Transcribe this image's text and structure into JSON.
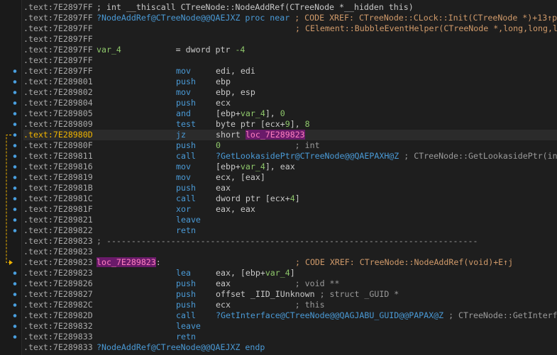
{
  "colors": {
    "background": "#1e1e1e",
    "address": "#a9a9a9",
    "mnemonic": "#4a9ad6",
    "name": "#4a9ad6",
    "number": "#8fc86b",
    "comment": "#9a9a9a",
    "xref": "#d09a6a",
    "highlight_bg": "#6a1a6a",
    "highlight_fg": "#ff7fbf",
    "jump_arrow": "#f0b400",
    "breakpoint_dot": "#4aa0e0"
  },
  "lines": [
    {
      "addr": ".text:7E2897FF",
      "label": [
        {
          "t": "; int __thiscall CTreeNode::NodeAddRef(CTreeNode *__hidden this)",
          "c": "plain"
        }
      ]
    },
    {
      "addr": ".text:7E2897FF",
      "label": [
        {
          "t": "?NodeAddRef@CTreeNode@@QAEJXZ proc near",
          "c": "func"
        },
        {
          "t": " ; CODE XREF: CTreeNode::CLock::Init(CTreeNode *)+13↑p",
          "c": "xref"
        }
      ]
    },
    {
      "addr": ".text:7E2897FF",
      "xref": "; CElement::BubbleEventHelper(CTreeNode *,long,long,long"
    },
    {
      "addr": ".text:7E2897FF"
    },
    {
      "addr": ".text:7E2897FF",
      "label": [
        {
          "t": "var_4",
          "c": "var"
        },
        {
          "t": "           = dword ptr ",
          "c": "plain"
        },
        {
          "t": "-4",
          "c": "num"
        }
      ]
    },
    {
      "addr": ".text:7E2897FF"
    },
    {
      "addr": ".text:7E2897FF",
      "dot": true,
      "mn": "mov",
      "op": [
        {
          "t": "edi, edi",
          "c": "plain"
        }
      ]
    },
    {
      "addr": ".text:7E289801",
      "dot": true,
      "mn": "push",
      "op": [
        {
          "t": "ebp",
          "c": "plain"
        }
      ]
    },
    {
      "addr": ".text:7E289802",
      "dot": true,
      "mn": "mov",
      "op": [
        {
          "t": "ebp, esp",
          "c": "plain"
        }
      ]
    },
    {
      "addr": ".text:7E289804",
      "dot": true,
      "mn": "push",
      "op": [
        {
          "t": "ecx",
          "c": "plain"
        }
      ]
    },
    {
      "addr": ".text:7E289805",
      "dot": true,
      "mn": "and",
      "op": [
        {
          "t": "[ebp+",
          "c": "plain"
        },
        {
          "t": "var_4",
          "c": "var"
        },
        {
          "t": "], ",
          "c": "plain"
        },
        {
          "t": "0",
          "c": "num"
        }
      ]
    },
    {
      "addr": ".text:7E289809",
      "dot": true,
      "mn": "test",
      "op": [
        {
          "t": "byte ptr [ecx+",
          "c": "plain"
        },
        {
          "t": "9",
          "c": "num"
        },
        {
          "t": "], ",
          "c": "plain"
        },
        {
          "t": "8",
          "c": "num"
        }
      ]
    },
    {
      "addr": ".text:7E28980D",
      "dot": true,
      "hl": true,
      "mn": "jz",
      "op": [
        {
          "t": "short ",
          "c": "plain"
        },
        {
          "t": "loc_7E289823",
          "c": "hl"
        }
      ]
    },
    {
      "addr": ".text:7E28980F",
      "dot": true,
      "mn": "push",
      "op": [
        {
          "t": "0",
          "c": "num"
        },
        {
          "t": "               ; int",
          "c": "cm"
        }
      ]
    },
    {
      "addr": ".text:7E289811",
      "dot": true,
      "mn": "call",
      "op": [
        {
          "t": "?GetLookasidePtr@CTreeNode@@QAEPAXH@Z",
          "c": "name"
        },
        {
          "t": " ; CTreeNode::GetLookasidePtr(int)",
          "c": "cm"
        }
      ]
    },
    {
      "addr": ".text:7E289816",
      "dot": true,
      "mn": "mov",
      "op": [
        {
          "t": "[ebp+",
          "c": "plain"
        },
        {
          "t": "var_4",
          "c": "var"
        },
        {
          "t": "], eax",
          "c": "plain"
        }
      ]
    },
    {
      "addr": ".text:7E289819",
      "dot": true,
      "mn": "mov",
      "op": [
        {
          "t": "ecx, [eax]",
          "c": "plain"
        }
      ]
    },
    {
      "addr": ".text:7E28981B",
      "dot": true,
      "mn": "push",
      "op": [
        {
          "t": "eax",
          "c": "plain"
        }
      ]
    },
    {
      "addr": ".text:7E28981C",
      "dot": true,
      "mn": "call",
      "op": [
        {
          "t": "dword ptr [ecx+",
          "c": "plain"
        },
        {
          "t": "4",
          "c": "num"
        },
        {
          "t": "]",
          "c": "plain"
        }
      ]
    },
    {
      "addr": ".text:7E28981F",
      "dot": true,
      "mn": "xor",
      "op": [
        {
          "t": "eax, eax",
          "c": "plain"
        }
      ]
    },
    {
      "addr": ".text:7E289821",
      "dot": true,
      "mn": "leave"
    },
    {
      "addr": ".text:7E289822",
      "dot": true,
      "mn": "retn"
    },
    {
      "addr": ".text:7E289823",
      "sep": "; ---------------------------------------------------------------------------"
    },
    {
      "addr": ".text:7E289823"
    },
    {
      "addr": ".text:7E289823",
      "label": [
        {
          "t": "loc_7E289823",
          "c": "hl"
        },
        {
          "t": ":",
          "c": "plain"
        }
      ],
      "xref": "; CODE XREF: CTreeNode::NodeAddRef(void)+E↑j"
    },
    {
      "addr": ".text:7E289823",
      "dot": true,
      "mn": "lea",
      "op": [
        {
          "t": "eax, [ebp+",
          "c": "plain"
        },
        {
          "t": "var_4",
          "c": "var"
        },
        {
          "t": "]",
          "c": "plain"
        }
      ]
    },
    {
      "addr": ".text:7E289826",
      "dot": true,
      "mn": "push",
      "op": [
        {
          "t": "eax",
          "c": "plain"
        },
        {
          "t": "             ; void **",
          "c": "cm"
        }
      ]
    },
    {
      "addr": ".text:7E289827",
      "dot": true,
      "mn": "push",
      "op": [
        {
          "t": "offset _IID_IUnknown",
          "c": "plain"
        },
        {
          "t": " ; struct _GUID *",
          "c": "cm"
        }
      ]
    },
    {
      "addr": ".text:7E28982C",
      "dot": true,
      "mn": "push",
      "op": [
        {
          "t": "ecx",
          "c": "plain"
        },
        {
          "t": "             ; this",
          "c": "cm"
        }
      ]
    },
    {
      "addr": ".text:7E28982D",
      "dot": true,
      "mn": "call",
      "op": [
        {
          "t": "?GetInterface@CTreeNode@@QAGJABU_GUID@@PAPAX@Z",
          "c": "name"
        },
        {
          "t": " ; CTreeNode::GetInterface(_GUID const &,void * *)",
          "c": "cm"
        }
      ]
    },
    {
      "addr": ".text:7E289832",
      "dot": true,
      "mn": "leave"
    },
    {
      "addr": ".text:7E289833",
      "dot": true,
      "mn": "retn"
    },
    {
      "addr": ".text:7E289833",
      "label": [
        {
          "t": "?NodeAddRef@CTreeNode@@QAEJXZ endp",
          "c": "func"
        }
      ]
    }
  ]
}
